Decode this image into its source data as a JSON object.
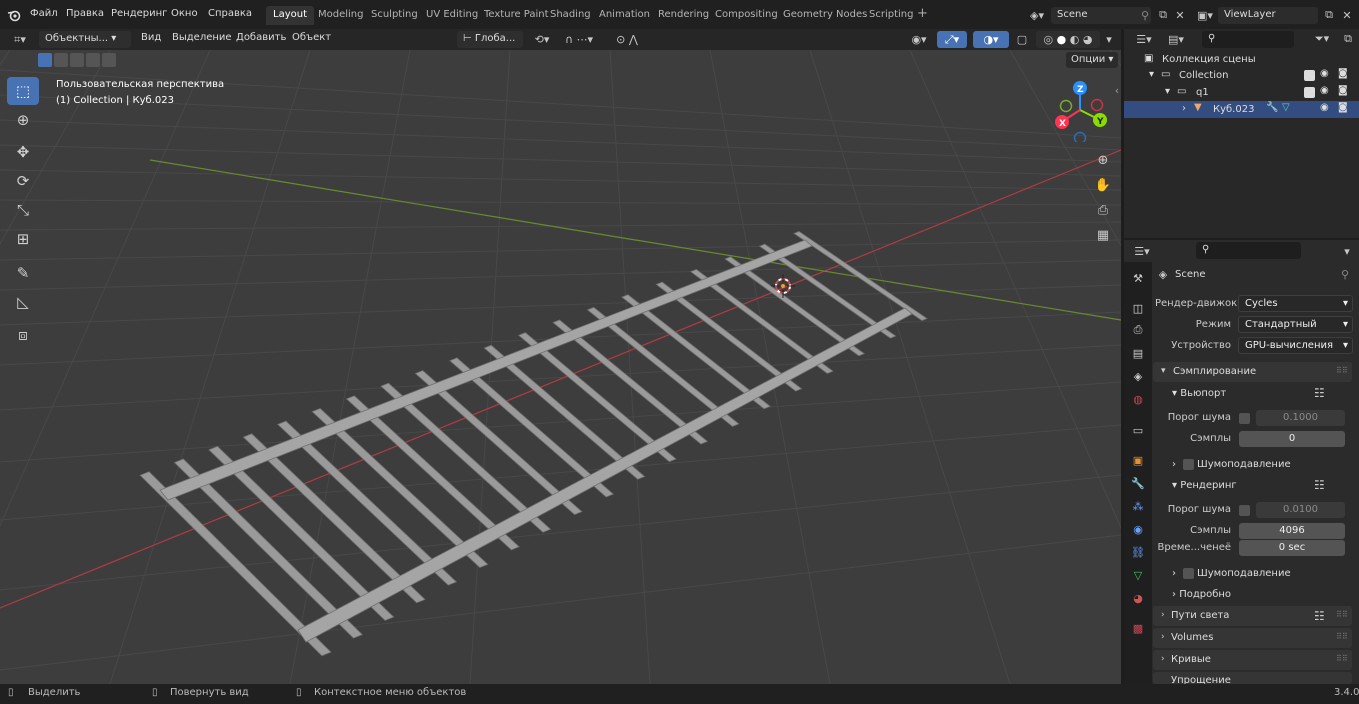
{
  "topbar": {
    "menus": [
      "Файл",
      "Правка",
      "Рендеринг",
      "Окно",
      "Справка"
    ],
    "workspaces": [
      "Layout",
      "Modeling",
      "Sculpting",
      "UV Editing",
      "Texture Paint",
      "Shading",
      "Animation",
      "Rendering",
      "Compositing",
      "Geometry Nodes",
      "Scripting"
    ],
    "add_workspace": "+",
    "scene_name": "Scene",
    "view_layer": "ViewLayer"
  },
  "viewport_header": {
    "mode": "Объектны...",
    "menus": [
      "Вид",
      "Выделение",
      "Добавить",
      "Объект"
    ],
    "transform_orientation": "Глоба...",
    "options_label": "Опции"
  },
  "viewport": {
    "view_name": "Пользовательская перспектива",
    "collection_info": "(1) Collection | Куб.023",
    "gizmo": {
      "z": "Z",
      "y": "Y",
      "x": "X"
    }
  },
  "outliner": {
    "rows": [
      {
        "label": "Коллекция сцены"
      },
      {
        "label": "Collection"
      },
      {
        "label": "q1"
      },
      {
        "label": "Куб.023"
      }
    ]
  },
  "properties": {
    "scene_label": "Scene",
    "render_engine_label": "Рендер-движок",
    "render_engine_value": "Cycles",
    "mode_label": "Режим",
    "mode_value": "Стандартный",
    "device_label": "Устройство",
    "device_value": "GPU-вычисления",
    "sampling_title": "Сэмплирование",
    "viewport_title": "Вьюпорт",
    "vp_noise_label": "Порог шума",
    "vp_noise_value": "0.1000",
    "vp_samples_label": "Сэмплы",
    "vp_samples_value": "0",
    "vp_denoise_label": "Шумоподавление",
    "render_title": "Рендеринг",
    "r_noise_label": "Порог шума",
    "r_noise_value": "0.0100",
    "r_samples_label": "Сэмплы",
    "r_samples_value": "4096",
    "r_time_label": "Време...ченеё",
    "r_time_value": "0 sec",
    "r_denoise_label": "Шумоподавление",
    "advanced_label": "Подробно",
    "light_paths": "Пути света",
    "volumes": "Volumes",
    "curves": "Кривые",
    "simplify": "Упрощение"
  },
  "statusbar": {
    "select": "Выделить",
    "rotate": "Повернуть вид",
    "context": "Контекстное меню объектов",
    "version": "3.4.0"
  },
  "colors": {
    "accent": "#4772b3",
    "x_axis": "#ff3352",
    "y_axis": "#8bdc00",
    "z_axis": "#2890ff"
  }
}
